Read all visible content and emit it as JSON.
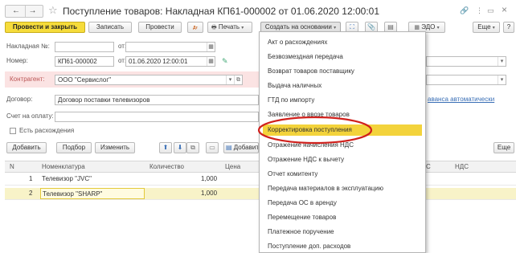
{
  "window": {
    "title": "Поступление товаров: Накладная КП61-000002 от 01.06.2020 12:00:01"
  },
  "toolbar": {
    "post_close": "Провести и закрыть",
    "save": "Записать",
    "post": "Провести",
    "print": "Печать",
    "create_based": "Создать на основании",
    "edo": "ЭДО",
    "more": "Еще",
    "help": "?"
  },
  "form": {
    "invoice_label": "Накладная №:",
    "date_from_label": "от:",
    "number_label": "Номер:",
    "number_value": "КП61-000002",
    "number_date_label": "от:",
    "date_value": "01.06.2020 12:00:01",
    "counterparty_label": "Контрагент:",
    "counterparty_value": "ООО \"Сервислог\"",
    "contract_label": "Договор:",
    "contract_value": "Договор поставки телевизоров",
    "payment_invoice_label": "Счет на оплату:",
    "discrepancy_label": "Есть расхождения",
    "vat_link": "аванса автоматически"
  },
  "table_toolbar": {
    "add": "Добавить",
    "select": "Подбор",
    "change": "Изменить",
    "add2": "Добавит",
    "more": "Еще"
  },
  "table": {
    "headers": [
      "N",
      "Номенклатура",
      "Количество",
      "Цена",
      "С",
      "НДС"
    ],
    "rows": [
      {
        "n": "1",
        "item": "Телевизор \"JVC\"",
        "qty": "1,000"
      },
      {
        "n": "2",
        "item": "Телевизор \"SHARP\"",
        "qty": "1,000"
      }
    ]
  },
  "dropdown": {
    "items": [
      "Акт о расхождениях",
      "Безвозмездная передача",
      "Возврат товаров поставщику",
      "Выдача наличных",
      "ГТД по импорту",
      "Заявление о ввозе товаров",
      "Корректировка поступления",
      "Отражение начисления НДС",
      "Отражение НДС к вычету",
      "Отчет комитенту",
      "Передача материалов в эксплуатацию",
      "Передача ОС в аренду",
      "Перемещение товаров",
      "Платежное поручение",
      "Поступление доп. расходов"
    ],
    "highlighted_index": 6
  },
  "colors": {
    "accent_yellow": "#f3d33c",
    "annotation_red": "#d0201c",
    "counterparty_bg": "#fbe3e3"
  }
}
